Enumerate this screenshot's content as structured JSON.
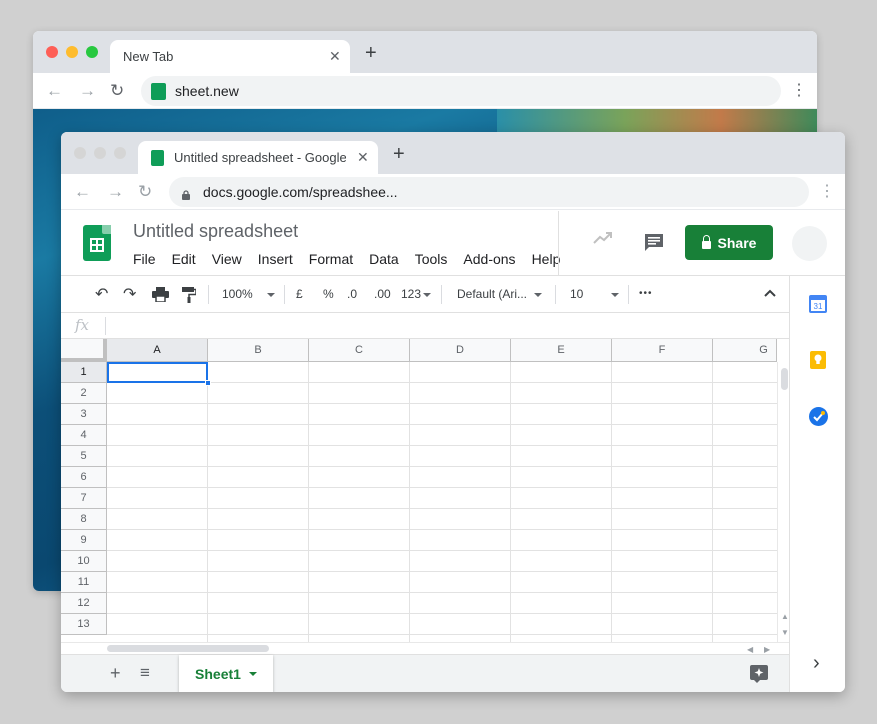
{
  "back_window": {
    "tab_title": "New Tab",
    "tab_close": "✕",
    "new_tab": "+",
    "url": "sheet.new"
  },
  "front_window": {
    "tab_title": "Untitled spreadsheet - Google Sheets",
    "tab_close": "✕",
    "new_tab": "+",
    "url": "docs.google.com/spreadshee..."
  },
  "header": {
    "doc_title": "Untitled spreadsheet",
    "menu": [
      "File",
      "Edit",
      "View",
      "Insert",
      "Format",
      "Data",
      "Tools",
      "Add-ons",
      "Help"
    ],
    "share_label": "Share"
  },
  "format_bar": {
    "zoom": "100%",
    "currency": "£",
    "percent": "%",
    "decrease_decimals": ".0",
    "increase_decimals": ".00",
    "number_format": "123",
    "font": "Default (Ari...",
    "font_size": "10",
    "more": "•••"
  },
  "formula_bar": {
    "fx_label": "fx",
    "value": ""
  },
  "grid": {
    "columns": [
      "A",
      "B",
      "C",
      "D",
      "E",
      "F",
      "G"
    ],
    "rows": [
      "1",
      "2",
      "3",
      "4",
      "5",
      "6",
      "7",
      "8",
      "9",
      "10",
      "11",
      "12",
      "13"
    ],
    "selected_cell": "A1"
  },
  "sheet_bar": {
    "add": "+",
    "list": "≡",
    "sheet_tab": "Sheet1"
  },
  "side_panel": {
    "calendar_day": "31",
    "expand": "›"
  },
  "colors": {
    "sheets_green": "#0f9d58",
    "share_green": "#188038",
    "selection_blue": "#1a73e8",
    "calendar_blue": "#4285f4",
    "keep_yellow": "#fbbc04",
    "tasks_blue": "#1a73e8"
  }
}
